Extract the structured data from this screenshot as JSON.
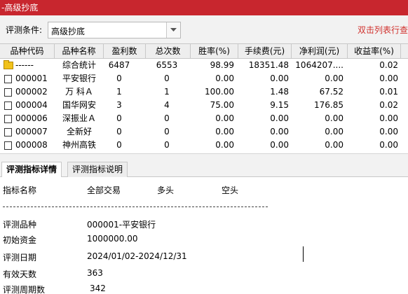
{
  "window": {
    "title": "-高级抄底"
  },
  "condition": {
    "label": "评测条件:",
    "value": "高级抄底",
    "hint": "双击列表行查"
  },
  "table": {
    "columns": [
      "品种代码",
      "品种名称",
      "盈利数",
      "总次数",
      "胜率(%)",
      "手续费(元)",
      "净利润(元)",
      "收益率(%)"
    ],
    "rows": [
      {
        "code": "------",
        "name": "综合统计",
        "wins": "6487",
        "total": "6553",
        "rate": "98.99",
        "fee": "18351.48",
        "profit": "1064207....",
        "ret": "0.02",
        "icon": "folder-icon"
      },
      {
        "code": "000001",
        "name": "平安银行",
        "wins": "0",
        "total": "0",
        "rate": "0.00",
        "fee": "0.00",
        "profit": "0.00",
        "ret": "0.00",
        "icon": "document-icon"
      },
      {
        "code": "000002",
        "name": "万 科Ａ",
        "wins": "1",
        "total": "1",
        "rate": "100.00",
        "fee": "1.48",
        "profit": "67.52",
        "ret": "0.01",
        "icon": "document-icon"
      },
      {
        "code": "000004",
        "name": "国华网安",
        "wins": "3",
        "total": "4",
        "rate": "75.00",
        "fee": "9.15",
        "profit": "176.85",
        "ret": "0.02",
        "icon": "document-icon"
      },
      {
        "code": "000006",
        "name": "深振业Ａ",
        "wins": "0",
        "total": "0",
        "rate": "0.00",
        "fee": "0.00",
        "profit": "0.00",
        "ret": "0.00",
        "icon": "document-icon"
      },
      {
        "code": "000007",
        "name": "全新好",
        "wins": "0",
        "total": "0",
        "rate": "0.00",
        "fee": "0.00",
        "profit": "0.00",
        "ret": "0.00",
        "icon": "document-icon"
      },
      {
        "code": "000008",
        "name": "神州高铁",
        "wins": "0",
        "total": "0",
        "rate": "0.00",
        "fee": "0.00",
        "profit": "0.00",
        "ret": "0.00",
        "icon": "document-icon"
      }
    ]
  },
  "tabs": [
    {
      "label": "评测指标详情",
      "active": true
    },
    {
      "label": "评测指标说明",
      "active": false
    }
  ],
  "details": {
    "headers": {
      "name": "指标名称",
      "all": "全部交易",
      "long": "多头",
      "short": "空头"
    },
    "items": [
      {
        "label": "评测品种",
        "value": "000001-平安银行"
      },
      {
        "label": "初始资金",
        "value": "1000000.00"
      },
      {
        "label": "评测日期",
        "value": "2024/01/02-2024/12/31"
      },
      {
        "label": "有效天数",
        "value": "363"
      },
      {
        "label": "评测周期数",
        "value": "342"
      }
    ]
  }
}
